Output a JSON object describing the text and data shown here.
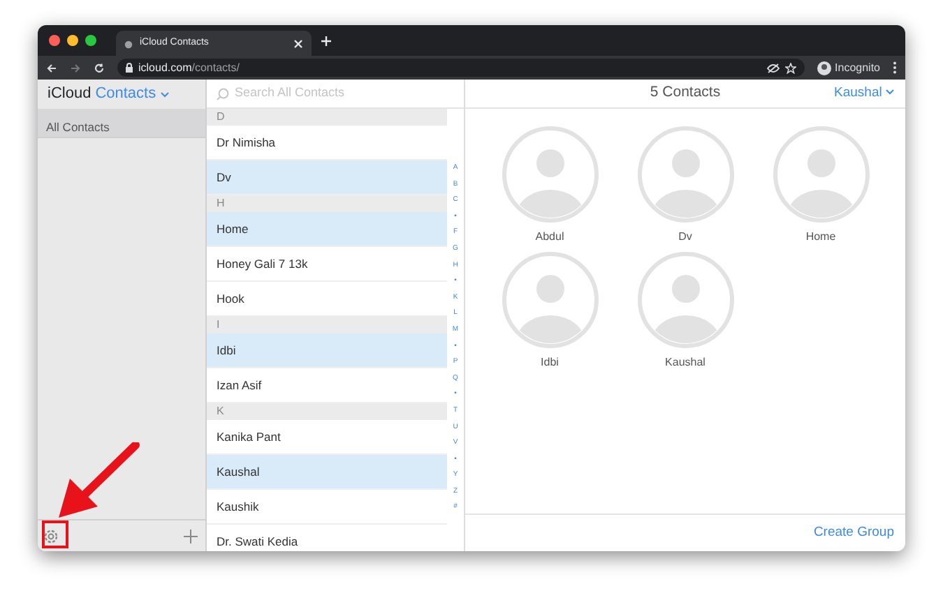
{
  "browser": {
    "tab_title": "iCloud Contacts",
    "url_host": "icloud.com",
    "url_path": "/contacts/",
    "profile": "Incognito"
  },
  "sidebar": {
    "app_name": "iCloud",
    "app_section": "Contacts",
    "groups": [
      {
        "label": "All Contacts",
        "selected": true
      }
    ]
  },
  "search": {
    "placeholder": "Search All Contacts"
  },
  "contact_list": [
    {
      "letter": "D",
      "contacts": [
        {
          "name": "Dr Nimisha",
          "selected": false
        },
        {
          "name": "Dv",
          "selected": true
        }
      ]
    },
    {
      "letter": "H",
      "contacts": [
        {
          "name": "Home",
          "selected": true
        },
        {
          "name": "Honey Gali 7 13k",
          "selected": false
        },
        {
          "name": "Hook",
          "selected": false
        }
      ]
    },
    {
      "letter": "I",
      "contacts": [
        {
          "name": "Idbi",
          "selected": true
        },
        {
          "name": "Izan Asif",
          "selected": false
        }
      ]
    },
    {
      "letter": "K",
      "contacts": [
        {
          "name": "Kanika Pant",
          "selected": false
        },
        {
          "name": "Kaushal",
          "selected": true
        },
        {
          "name": "Kaushik",
          "selected": false
        },
        {
          "name": "Dr. Swati Kedia",
          "selected": false
        }
      ]
    }
  ],
  "index_letters": [
    "A",
    "B",
    "C",
    "•",
    "F",
    "G",
    "H",
    "•",
    "K",
    "L",
    "M",
    "•",
    "P",
    "Q",
    "•",
    "T",
    "U",
    "V",
    "•",
    "Y",
    "Z",
    "#"
  ],
  "detail": {
    "title": "5 Contacts",
    "user": "Kaushal",
    "cards": [
      "Abdul",
      "Dv",
      "Home",
      "Idbi",
      "Kaushal"
    ],
    "footer_button": "Create Group"
  }
}
